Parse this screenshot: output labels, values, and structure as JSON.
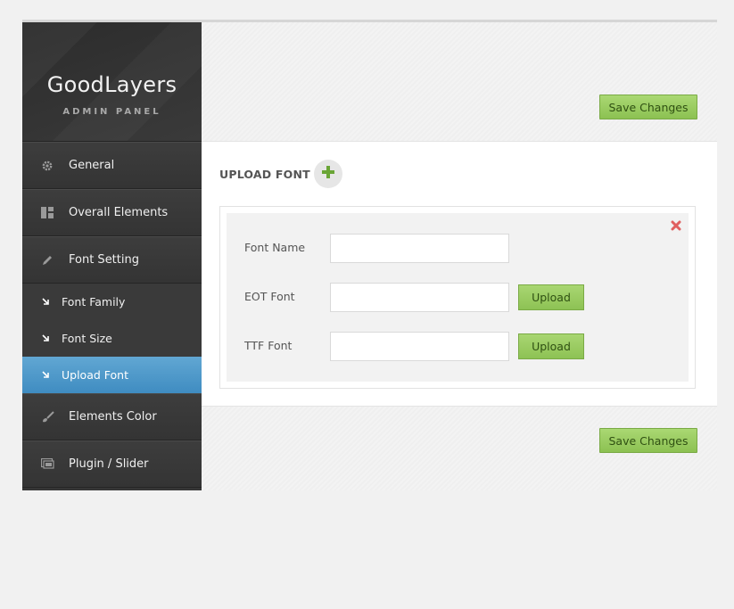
{
  "brand": {
    "title": "GoodLayers",
    "subtitle": "ADMIN PANEL"
  },
  "sidebar": {
    "items": [
      {
        "label": "General",
        "icon": "gear-icon"
      },
      {
        "label": "Overall Elements",
        "icon": "layout-icon"
      },
      {
        "label": "Font Setting",
        "icon": "pencil-icon"
      },
      {
        "label": "Elements Color",
        "icon": "brush-icon"
      },
      {
        "label": "Plugin / Slider",
        "icon": "slider-icon"
      }
    ],
    "subitems": [
      {
        "label": "Font Family"
      },
      {
        "label": "Font Size"
      },
      {
        "label": "Upload Font",
        "active": true
      }
    ]
  },
  "toolbar": {
    "save_label": "Save Changes"
  },
  "section": {
    "title": "UPLOAD FONT"
  },
  "form": {
    "font_name_label": "Font Name",
    "font_name_value": "",
    "eot_label": "EOT Font",
    "eot_value": "",
    "ttf_label": "TTF Font",
    "ttf_value": "",
    "upload_label": "Upload"
  },
  "colors": {
    "accent_blue": "#4f9acb",
    "button_green": "#8cc152",
    "close_red": "#e06060"
  }
}
